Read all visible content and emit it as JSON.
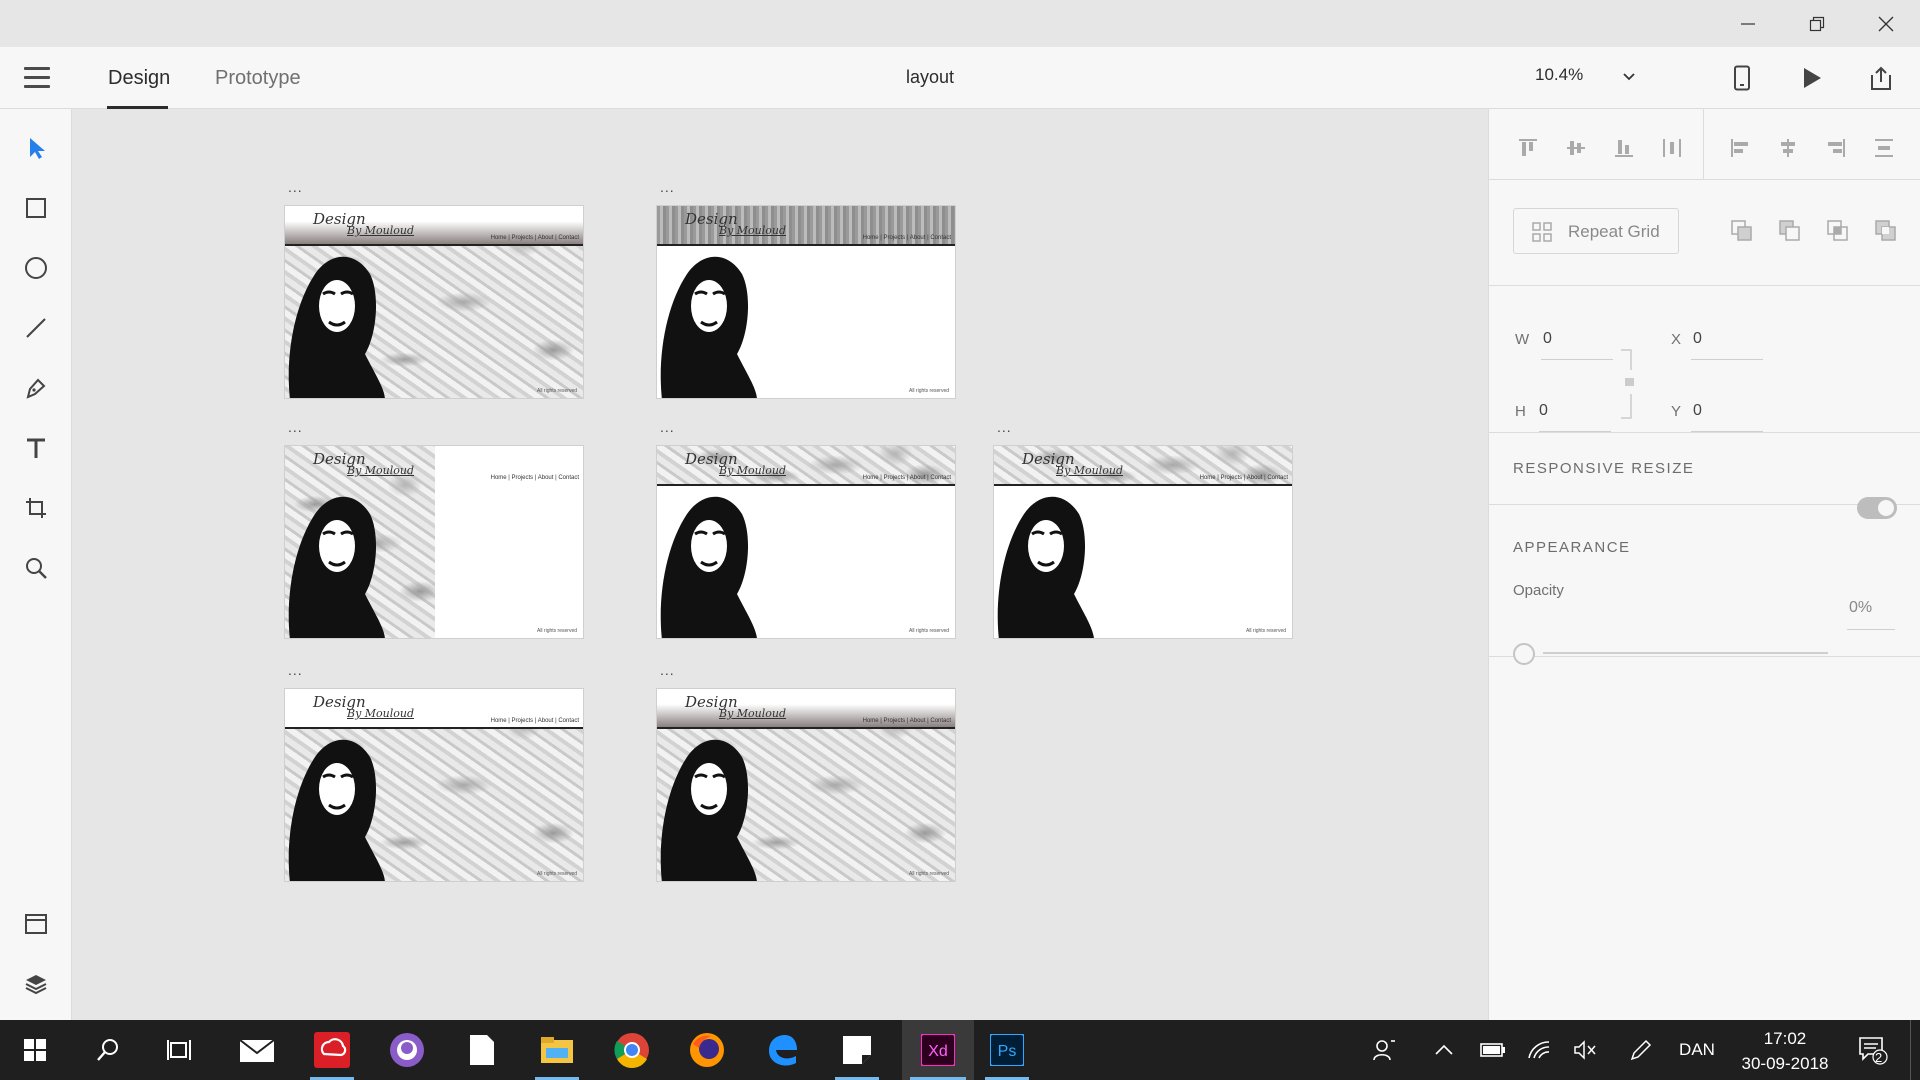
{
  "window": {
    "minimize_icon": "minimize-icon",
    "restore_icon": "restore-icon",
    "close_icon": "close-icon"
  },
  "header": {
    "tabs": [
      {
        "label": "Design",
        "active": true
      },
      {
        "label": "Prototype",
        "active": false
      }
    ],
    "document_title": "layout",
    "zoom": "10.4%"
  },
  "toolbar": {
    "tools": [
      "select-tool",
      "rectangle-tool",
      "ellipse-tool",
      "line-tool",
      "pen-tool",
      "text-tool",
      "artboard-tool",
      "zoom-tool"
    ],
    "bottom": [
      "assets-panel",
      "layers-panel"
    ]
  },
  "artboards": [
    {
      "dots": "...",
      "header": "light",
      "body": "marble",
      "nav": "Home | Projects | About | Contact",
      "logo": "Design",
      "logo_sub": "By Mouloud",
      "footer": "All rights reserved"
    },
    {
      "dots": "...",
      "header": "noise",
      "body": "white",
      "nav": "Home | Projects | About | Contact",
      "logo": "Design",
      "logo_sub": "By Mouloud",
      "footer": "All rights reserved"
    },
    {
      "dots": "...",
      "header": "none",
      "body": "sidebar",
      "nav": "Home | Projects | About | Contact",
      "logo": "Design",
      "logo_sub": "By Mouloud",
      "footer": "All rights reserved"
    },
    {
      "dots": "...",
      "header": "marble",
      "body": "white",
      "nav": "Home | Projects | About | Contact",
      "logo": "Design",
      "logo_sub": "By Mouloud",
      "footer": "All rights reserved"
    },
    {
      "dots": "...",
      "header": "marble",
      "body": "white",
      "nav": "Home | Projects | About | Contact",
      "logo": "Design",
      "logo_sub": "By Mouloud",
      "footer": "All rights reserved"
    },
    {
      "dots": "...",
      "header": "white",
      "body": "marble",
      "nav": "Home | Projects | About | Contact",
      "logo": "Design",
      "logo_sub": "By Mouloud",
      "footer": "All rights reserved"
    },
    {
      "dots": "...",
      "header": "gradient",
      "body": "marble",
      "nav": "Home | Projects | About | Contact",
      "logo": "Design",
      "logo_sub": "By Mouloud",
      "footer": "All rights reserved"
    }
  ],
  "panel": {
    "repeat_grid": "Repeat Grid",
    "w_label": "W",
    "w_value": "0",
    "h_label": "H",
    "h_value": "0",
    "x_label": "X",
    "x_value": "0",
    "y_label": "Y",
    "y_value": "0",
    "responsive_resize": "RESPONSIVE RESIZE",
    "appearance": "APPEARANCE",
    "opacity_label": "Opacity",
    "opacity_value": "0%"
  },
  "taskbar": {
    "language": "DAN",
    "time": "17:02",
    "date": "30-09-2018",
    "notification_count": "2"
  },
  "colors": {
    "accent": "#2680eb",
    "taskbar": "#1f1f1f",
    "xd_pink": "#ff2bc2",
    "ps_blue": "#31a8ff"
  }
}
